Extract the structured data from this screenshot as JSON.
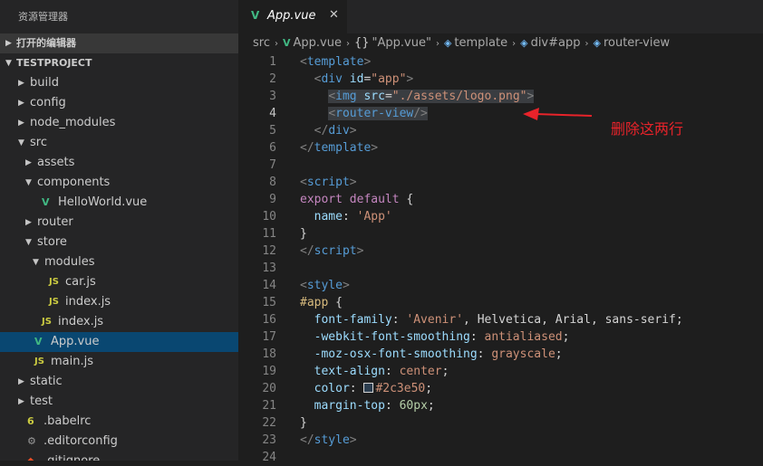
{
  "sidebar": {
    "title": "资源管理器",
    "open_editors": "打开的编辑器",
    "project": "TESTPROJECT",
    "tree": [
      {
        "label": "build",
        "type": "folder",
        "depth": 0,
        "expanded": false
      },
      {
        "label": "config",
        "type": "folder",
        "depth": 0,
        "expanded": false
      },
      {
        "label": "node_modules",
        "type": "folder",
        "depth": 0,
        "expanded": false
      },
      {
        "label": "src",
        "type": "folder",
        "depth": 0,
        "expanded": true
      },
      {
        "label": "assets",
        "type": "folder",
        "depth": 1,
        "expanded": false
      },
      {
        "label": "components",
        "type": "folder",
        "depth": 1,
        "expanded": true
      },
      {
        "label": "HelloWorld.vue",
        "type": "vue",
        "depth": 2
      },
      {
        "label": "router",
        "type": "folder",
        "depth": 1,
        "expanded": false
      },
      {
        "label": "store",
        "type": "folder",
        "depth": 1,
        "expanded": true
      },
      {
        "label": "modules",
        "type": "folder",
        "depth": 2,
        "expanded": true
      },
      {
        "label": "car.js",
        "type": "js",
        "depth": 3
      },
      {
        "label": "index.js",
        "type": "js",
        "depth": 3
      },
      {
        "label": "index.js",
        "type": "js",
        "depth": 2
      },
      {
        "label": "App.vue",
        "type": "vue",
        "depth": 1,
        "selected": true
      },
      {
        "label": "main.js",
        "type": "js",
        "depth": 1
      },
      {
        "label": "static",
        "type": "folder",
        "depth": 0,
        "expanded": false
      },
      {
        "label": "test",
        "type": "folder",
        "depth": 0,
        "expanded": false
      },
      {
        "label": ".babelrc",
        "type": "babel",
        "depth": 0
      },
      {
        "label": ".editorconfig",
        "type": "gear",
        "depth": 0
      },
      {
        "label": ".gitignore",
        "type": "git",
        "depth": 0
      }
    ]
  },
  "tab": {
    "label": "App.vue",
    "close": "✕"
  },
  "breadcrumbs": [
    "src",
    "App.vue",
    "\"App.vue\"",
    "template",
    "div#app",
    "router-view"
  ],
  "current_line": 4,
  "code_lines": [
    {
      "n": "1",
      "parts": [
        [
          "t-punc",
          "<"
        ],
        [
          "t-tag",
          "template"
        ],
        [
          "t-punc",
          ">"
        ]
      ]
    },
    {
      "n": "2",
      "parts": [
        [
          "",
          "  "
        ],
        [
          "t-punc",
          "<"
        ],
        [
          "t-tag",
          "div"
        ],
        [
          "",
          " "
        ],
        [
          "t-attr",
          "id"
        ],
        [
          "",
          "="
        ],
        [
          "t-str",
          "\"app\""
        ],
        [
          "t-punc",
          ">"
        ]
      ]
    },
    {
      "n": "3",
      "hl": true,
      "parts": [
        [
          "",
          "    "
        ],
        [
          "t-punc",
          "<"
        ],
        [
          "t-tag",
          "img"
        ],
        [
          "",
          " "
        ],
        [
          "t-attr",
          "src"
        ],
        [
          "",
          "="
        ],
        [
          "t-str",
          "\"./assets/logo.png\""
        ],
        [
          "t-punc",
          ">"
        ]
      ]
    },
    {
      "n": "4",
      "hl": true,
      "parts": [
        [
          "",
          "    "
        ],
        [
          "t-punc",
          "<"
        ],
        [
          "t-tag",
          "router-view"
        ],
        [
          "t-punc",
          "/>"
        ]
      ]
    },
    {
      "n": "5",
      "parts": [
        [
          "",
          "  "
        ],
        [
          "t-punc",
          "</"
        ],
        [
          "t-tag",
          "div"
        ],
        [
          "t-punc",
          ">"
        ]
      ]
    },
    {
      "n": "6",
      "parts": [
        [
          "t-punc",
          "</"
        ],
        [
          "t-tag",
          "template"
        ],
        [
          "t-punc",
          ">"
        ]
      ]
    },
    {
      "n": "7",
      "parts": []
    },
    {
      "n": "8",
      "parts": [
        [
          "t-punc",
          "<"
        ],
        [
          "t-tag",
          "script"
        ],
        [
          "t-punc",
          ">"
        ]
      ]
    },
    {
      "n": "9",
      "parts": [
        [
          "t-kw",
          "export"
        ],
        [
          "",
          " "
        ],
        [
          "t-kw",
          "default"
        ],
        [
          "",
          " {"
        ]
      ]
    },
    {
      "n": "10",
      "parts": [
        [
          "",
          "  "
        ],
        [
          "t-prop",
          "name"
        ],
        [
          "",
          ": "
        ],
        [
          "t-str",
          "'App'"
        ]
      ]
    },
    {
      "n": "11",
      "parts": [
        [
          "",
          "}"
        ]
      ]
    },
    {
      "n": "12",
      "parts": [
        [
          "t-punc",
          "</"
        ],
        [
          "t-tag",
          "script"
        ],
        [
          "t-punc",
          ">"
        ]
      ]
    },
    {
      "n": "13",
      "parts": []
    },
    {
      "n": "14",
      "parts": [
        [
          "t-punc",
          "<"
        ],
        [
          "t-tag",
          "style"
        ],
        [
          "t-punc",
          ">"
        ]
      ]
    },
    {
      "n": "15",
      "parts": [
        [
          "t-sel",
          "#app"
        ],
        [
          "",
          " {"
        ]
      ]
    },
    {
      "n": "16",
      "parts": [
        [
          "",
          "  "
        ],
        [
          "t-prop",
          "font-family"
        ],
        [
          "",
          ": "
        ],
        [
          "t-str",
          "'Avenir'"
        ],
        [
          "",
          ", "
        ],
        [
          "t-fn",
          "Helvetica"
        ],
        [
          "",
          ", "
        ],
        [
          "t-fn",
          "Arial"
        ],
        [
          "",
          ", "
        ],
        [
          "t-fn",
          "sans-serif"
        ],
        [
          "",
          ";"
        ]
      ]
    },
    {
      "n": "17",
      "parts": [
        [
          "",
          "  "
        ],
        [
          "t-prop",
          "-webkit-font-smoothing"
        ],
        [
          "",
          ": "
        ],
        [
          "t-str",
          "antialiased"
        ],
        [
          "",
          ";"
        ]
      ]
    },
    {
      "n": "18",
      "parts": [
        [
          "",
          "  "
        ],
        [
          "t-prop",
          "-moz-osx-font-smoothing"
        ],
        [
          "",
          ": "
        ],
        [
          "t-str",
          "grayscale"
        ],
        [
          "",
          ";"
        ]
      ]
    },
    {
      "n": "19",
      "parts": [
        [
          "",
          "  "
        ],
        [
          "t-prop",
          "text-align"
        ],
        [
          "",
          ": "
        ],
        [
          "t-str",
          "center"
        ],
        [
          "",
          ";"
        ]
      ]
    },
    {
      "n": "20",
      "parts": [
        [
          "",
          "  "
        ],
        [
          "t-prop",
          "color"
        ],
        [
          "",
          ": "
        ],
        [
          "swatch",
          ""
        ],
        [
          "t-str",
          "#2c3e50"
        ],
        [
          "",
          ";"
        ]
      ]
    },
    {
      "n": "21",
      "parts": [
        [
          "",
          "  "
        ],
        [
          "t-prop",
          "margin-top"
        ],
        [
          "",
          ": "
        ],
        [
          "t-num",
          "60px"
        ],
        [
          "",
          ";"
        ]
      ]
    },
    {
      "n": "22",
      "parts": [
        [
          "",
          "}"
        ]
      ]
    },
    {
      "n": "23",
      "parts": [
        [
          "t-punc",
          "</"
        ],
        [
          "t-tag",
          "style"
        ],
        [
          "t-punc",
          ">"
        ]
      ]
    },
    {
      "n": "24",
      "parts": []
    }
  ],
  "annotation": {
    "text": "删除这两行",
    "color": "#e8232a"
  },
  "colors": {
    "accent_vue": "#41b883",
    "selection": "#094771",
    "editor_bg": "#1e1e1e",
    "sidebar_bg": "#252526"
  }
}
